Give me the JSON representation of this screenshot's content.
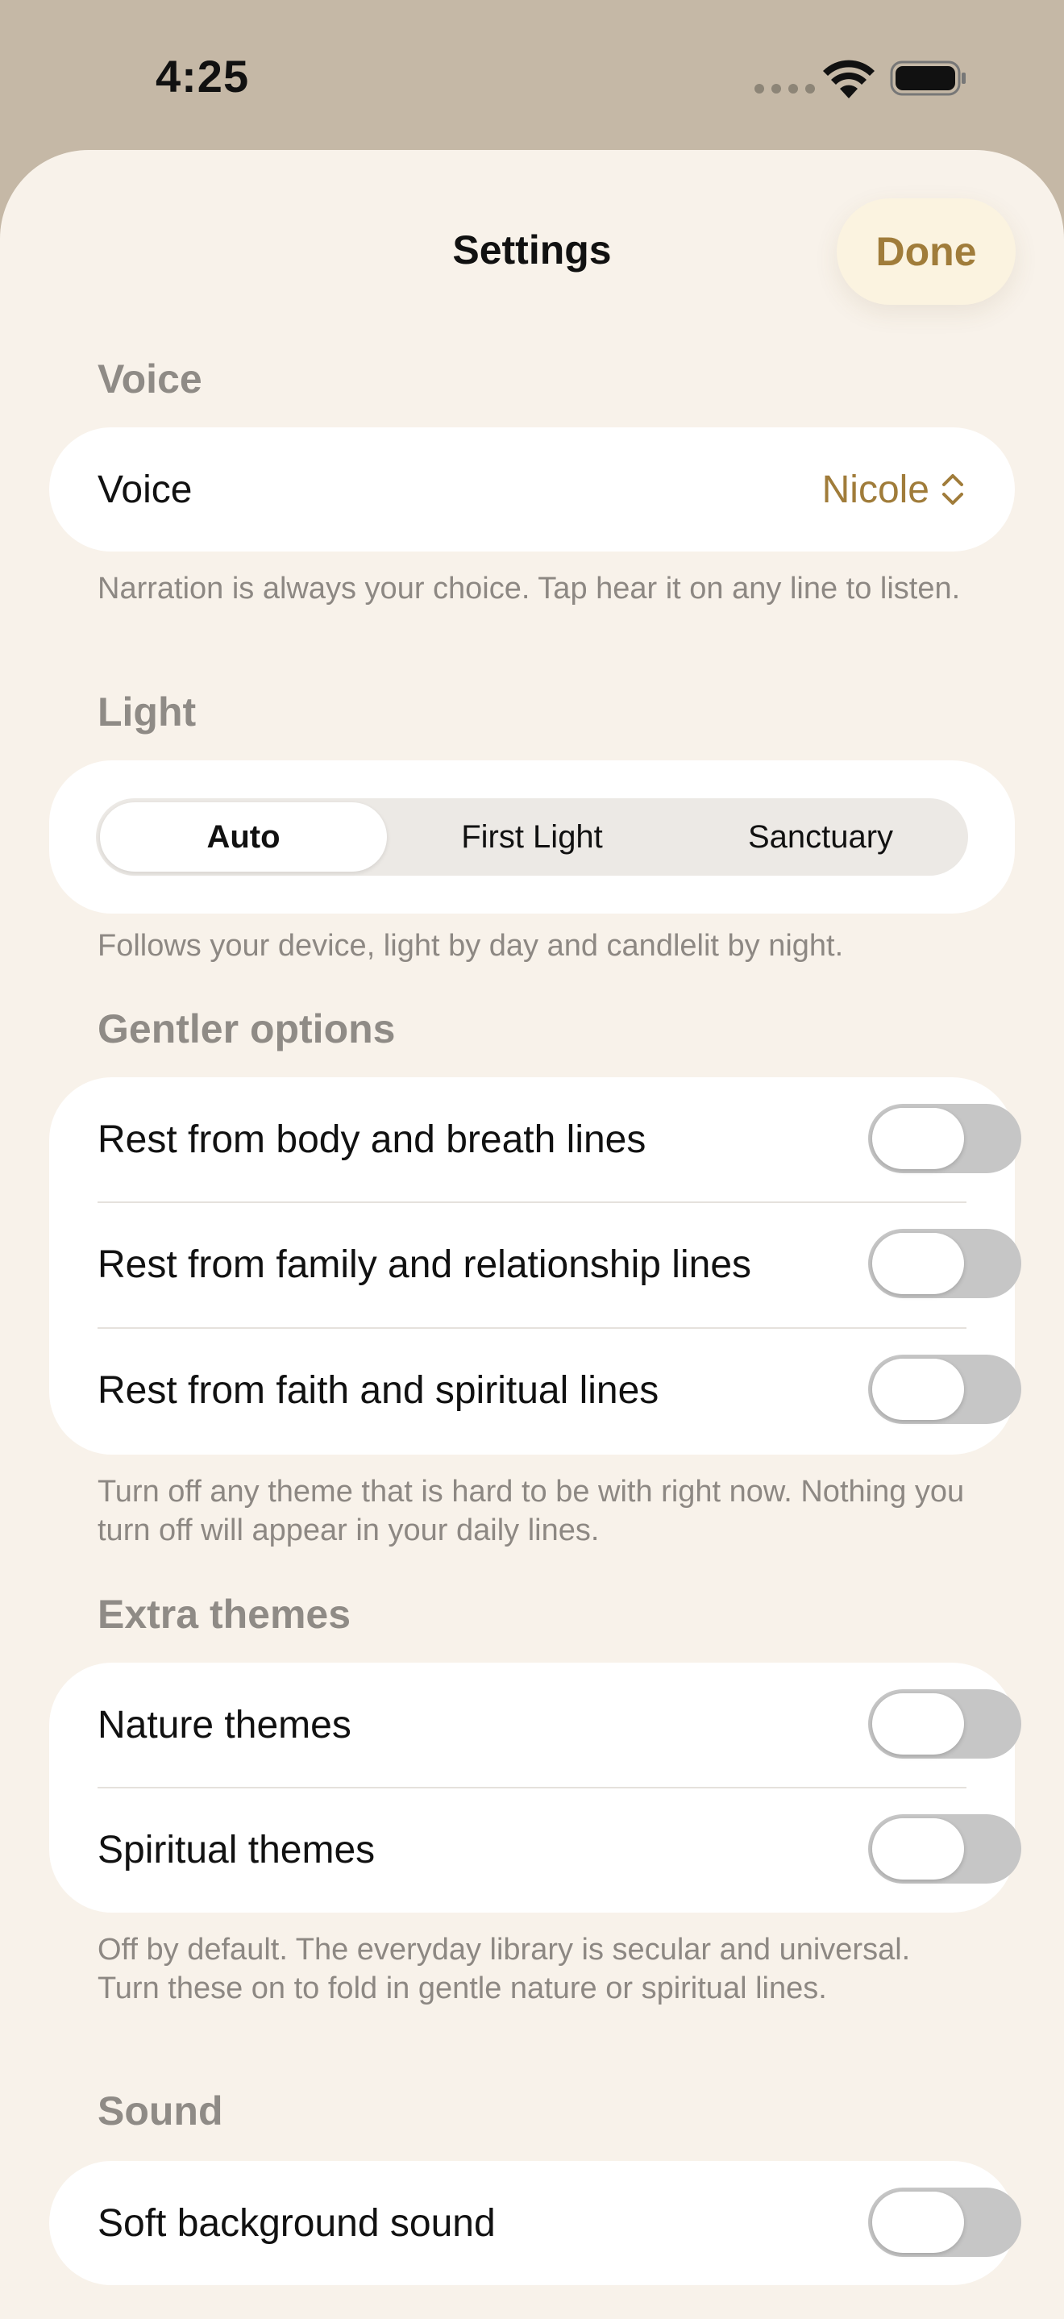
{
  "status_bar": {
    "time": "4:25"
  },
  "header": {
    "title": "Settings",
    "done_label": "Done"
  },
  "voice_section": {
    "title": "Voice",
    "row_label": "Voice",
    "selected_voice": "Nicole",
    "footnote": "Narration is always your choice. Tap hear it on any line to listen."
  },
  "light_section": {
    "title": "Light",
    "options": [
      "Auto",
      "First Light",
      "Sanctuary"
    ],
    "selected": "Auto",
    "footnote": "Follows your device, light by day and candlelit by night."
  },
  "gentler_section": {
    "title": "Gentler options",
    "rows": [
      {
        "label": "Rest from body and breath lines",
        "on": false
      },
      {
        "label": "Rest from family and relationship lines",
        "on": false
      },
      {
        "label": "Rest from faith and spiritual lines",
        "on": false
      }
    ],
    "footnote": "Turn off any theme that is hard to be with right now. Nothing you turn off will appear in your daily lines."
  },
  "extra_section": {
    "title": "Extra themes",
    "rows": [
      {
        "label": "Nature themes",
        "on": false
      },
      {
        "label": "Spiritual themes",
        "on": false
      }
    ],
    "footnote": "Off by default. The everyday library is secular and universal. Turn these on to fold in gentle nature or spiritual lines."
  },
  "sound_section": {
    "title": "Sound",
    "rows": [
      {
        "label": "Soft background sound",
        "on": false
      }
    ]
  },
  "colors": {
    "accent": "#a07c3a",
    "background": "#f8f2ea",
    "card": "#ffffff",
    "toggle_off": "#c6c6c6"
  }
}
